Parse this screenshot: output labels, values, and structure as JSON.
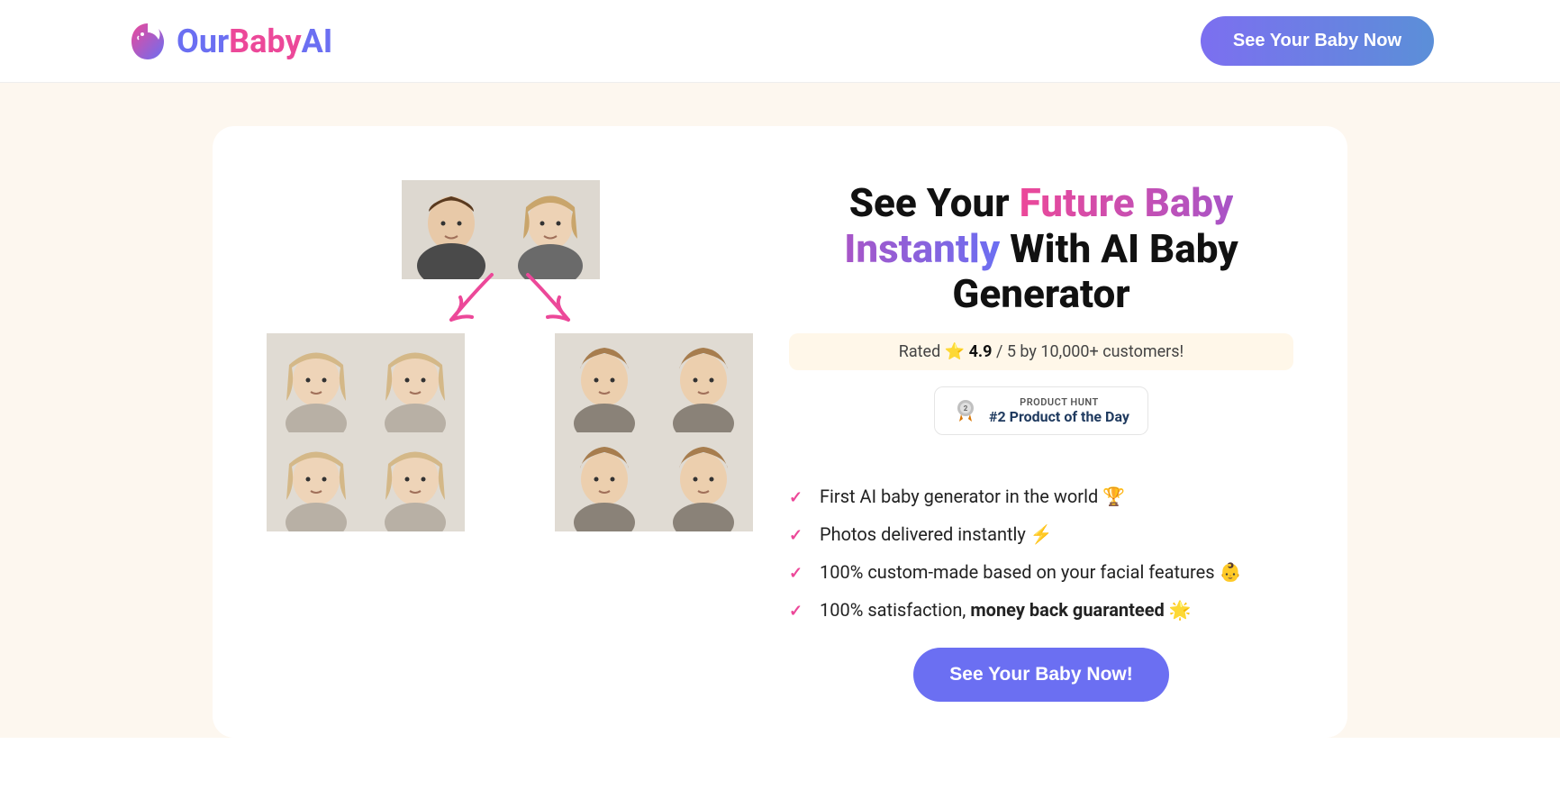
{
  "header": {
    "logo": {
      "our": "Our",
      "baby": "Baby",
      "ai": "AI"
    },
    "cta": "See Your Baby Now"
  },
  "hero": {
    "title_pre": "See Your ",
    "title_grad1": "Future Baby",
    "title_grad2": "Instantly",
    "title_post": " With AI Baby Generator",
    "rated_pre": "Rated ",
    "rated_score": "4.9",
    "rated_post": " / 5 by 10,000+ customers!",
    "ph_label": "PRODUCT HUNT",
    "ph_title": "#2 Product of the Day",
    "features": [
      {
        "text": "First AI baby generator in the world 🏆",
        "bold": ""
      },
      {
        "text": "Photos delivered instantly ⚡",
        "bold": ""
      },
      {
        "text": "100% custom-made based on your facial features 👶",
        "bold": ""
      },
      {
        "text": "100% satisfaction, ",
        "bold": "money back guaranteed 🌟"
      }
    ],
    "cta": "See Your Baby Now!"
  }
}
